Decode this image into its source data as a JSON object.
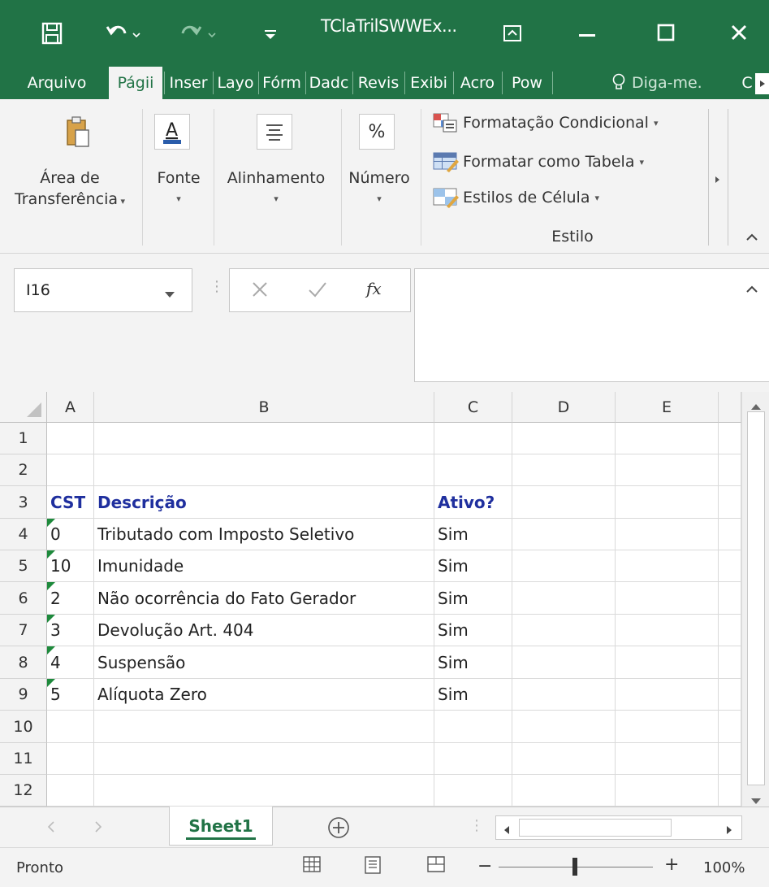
{
  "titlebar": {
    "title": "TClaTrilSWWEx...",
    "save_icon": "save-icon",
    "undo_icon": "undo-icon",
    "redo_icon": "redo-icon"
  },
  "tabs": [
    {
      "label": "Arquivo"
    },
    {
      "label": "Págii"
    },
    {
      "label": "Inser"
    },
    {
      "label": "Layo"
    },
    {
      "label": "Fórm"
    },
    {
      "label": "Dadc"
    },
    {
      "label": "Revis"
    },
    {
      "label": "Exibi"
    },
    {
      "label": "Acro"
    },
    {
      "label": "Pow"
    },
    {
      "label": "Diga-me."
    },
    {
      "label": "C"
    }
  ],
  "ribbon": {
    "clipboard": {
      "label1": "Área de",
      "label2": "Transferência"
    },
    "font": {
      "label": "Fonte"
    },
    "alignment": {
      "label": "Alinhamento"
    },
    "number": {
      "label": "Número",
      "symbol": "%"
    },
    "style": {
      "conditional": "Formatação Condicional",
      "as_table": "Formatar como Tabela",
      "cell_styles": "Estilos de Célula",
      "group_label": "Estilo"
    }
  },
  "formula_bar": {
    "name_box": "I16",
    "fx": "fx",
    "value": ""
  },
  "grid": {
    "columns": [
      "A",
      "B",
      "C",
      "D",
      "E"
    ],
    "row_numbers": [
      "1",
      "2",
      "3",
      "4",
      "5",
      "6",
      "7",
      "8",
      "9",
      "10",
      "11",
      "12"
    ],
    "headers": {
      "a": "CST",
      "b": "Descrição",
      "c": "Ativo?"
    },
    "rows": [
      {
        "a": "0",
        "b": "Tributado com Imposto Seletivo",
        "c": "Sim"
      },
      {
        "a": "10",
        "b": "Imunidade",
        "c": "Sim"
      },
      {
        "a": "2",
        "b": "Não ocorrência do Fato Gerador",
        "c": "Sim"
      },
      {
        "a": "3",
        "b": "Devolução Art. 404",
        "c": "Sim"
      },
      {
        "a": "4",
        "b": "Suspensão",
        "c": "Sim"
      },
      {
        "a": "5",
        "b": "Alíquota Zero",
        "c": "Sim"
      }
    ]
  },
  "sheets": {
    "active": "Sheet1"
  },
  "status": {
    "text": "Pronto",
    "zoom": "100%"
  },
  "colors": {
    "brand": "#217346",
    "header_text": "#1f2f9e"
  }
}
